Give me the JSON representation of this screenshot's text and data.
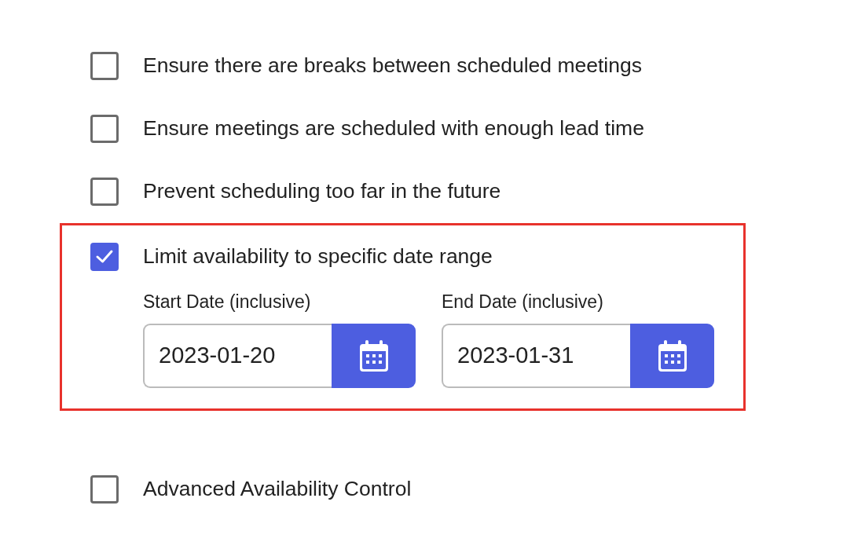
{
  "options": [
    {
      "label": "Ensure there are breaks between scheduled meetings",
      "checked": false
    },
    {
      "label": "Ensure meetings are scheduled with enough lead time",
      "checked": false
    },
    {
      "label": "Prevent scheduling too far in the future",
      "checked": false
    },
    {
      "label": "Limit availability to specific date range",
      "checked": true,
      "highlighted": true,
      "date_fields": [
        {
          "label": "Start Date (inclusive)",
          "value": "2023-01-20"
        },
        {
          "label": "End Date (inclusive)",
          "value": "2023-01-31"
        }
      ]
    },
    {
      "label": "Advanced Availability Control",
      "checked": false
    }
  ]
}
